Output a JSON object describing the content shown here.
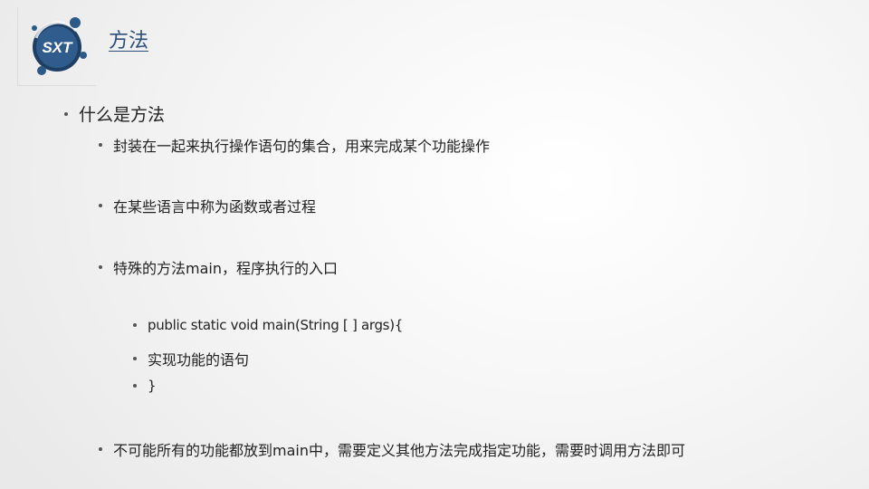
{
  "logo": {
    "text": "SXT"
  },
  "slide": {
    "title": "方法",
    "heading": "什么是方法",
    "points": [
      "封装在一起来执行操作语句的集合，用来完成某个功能操作",
      "在某些语言中称为函数或者过程",
      "特殊的方法main，程序执行的入口"
    ],
    "code_lines": [
      "public static void main(String  [ ] args){",
      "实现功能的语句",
      "}"
    ],
    "final_point": "不可能所有的功能都放到main中，需要定义其他方法完成指定功能，需要时调用方法即可"
  },
  "colors": {
    "title": "#2c4f7c",
    "logo_ring": "#24476e",
    "logo_dot": "#2c5a88"
  }
}
